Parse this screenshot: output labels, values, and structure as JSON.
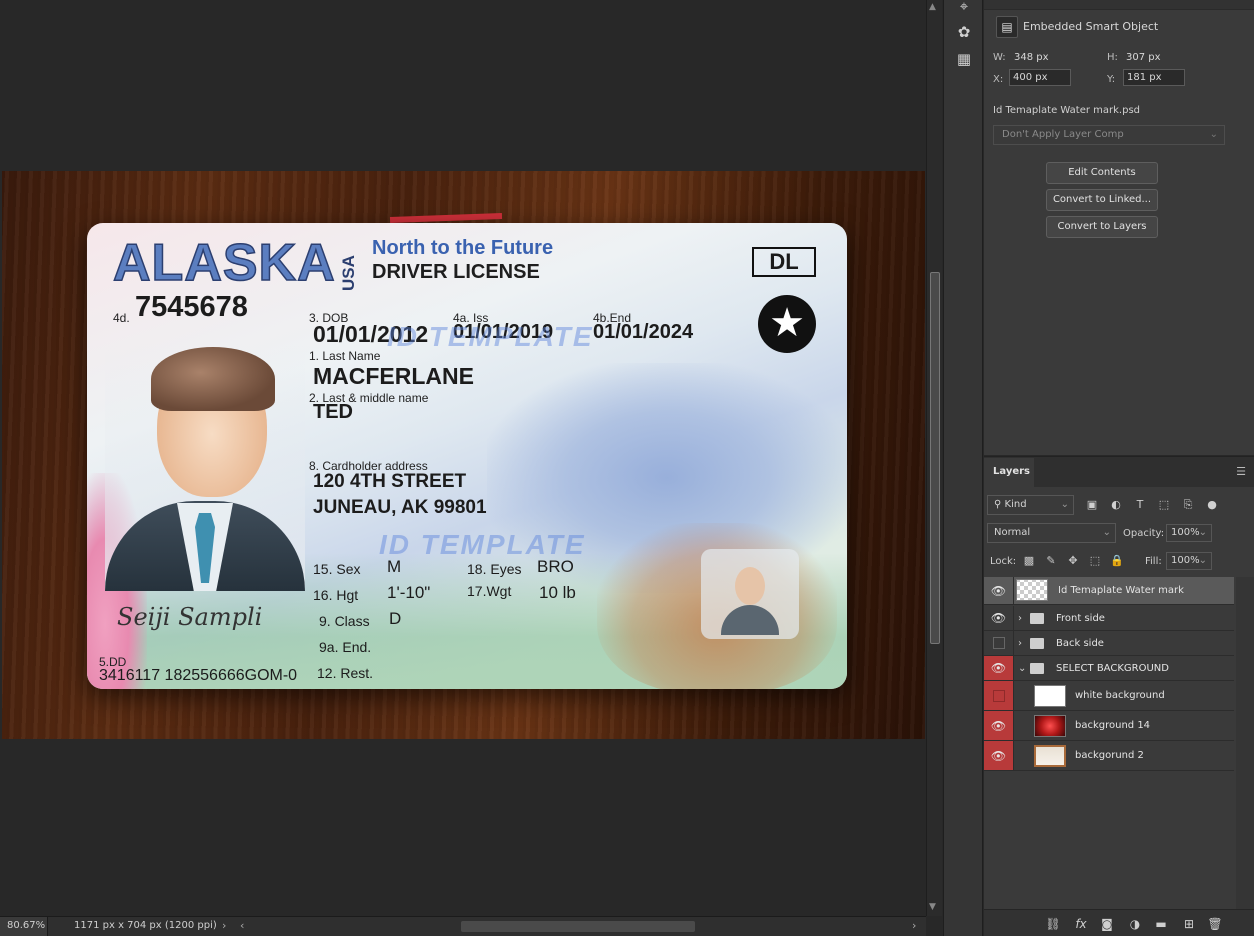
{
  "card": {
    "state": "ALASKA",
    "country": "USA",
    "motto": "North to the Future",
    "doc_type": "DRIVER LICENSE",
    "class_box": "DL",
    "id_label": "4d.",
    "id_number": "7545678",
    "dob_label": "3. DOB",
    "dob": "01/01/2012",
    "iss_label": "4a. Iss",
    "iss": "01/01/2019",
    "end_label": "4b.End",
    "end": "01/01/2024",
    "last_name_label": "1. Last Name",
    "last_name": "MACFERLANE",
    "first_name_label": "2. Last & middle name",
    "first_name": "TED",
    "address_label": "8. Cardholder address",
    "address_line1": "120 4TH STREET",
    "address_line2": "JUNEAU, AK 99801",
    "watermark": "ID TEMPLATE",
    "sex_label": "15. Sex",
    "sex": "M",
    "eyes_label": "18. Eyes",
    "eyes": "BRO",
    "hgt_label": "16. Hgt",
    "hgt": "1'-10\"",
    "wgt_label": "17.Wgt",
    "wgt": "10 lb",
    "class_label": "9.  Class",
    "class": "D",
    "endorse_label": "9a. End.",
    "rest_label": "12. Rest.",
    "signature": "Seiji Sampli",
    "dd_label": "5.DD",
    "dd": "3416117 182556666GOM-0"
  },
  "status_bar": {
    "zoom": "80.67%",
    "doc_info": "1171 px x 704 px (1200 ppi)"
  },
  "properties": {
    "title": "Embedded Smart Object",
    "w_label": "W:",
    "w_value": "348 px",
    "h_label": "H:",
    "h_value": "307 px",
    "x_label": "X:",
    "x_value": "400 px",
    "y_label": "Y:",
    "y_value": "181 px",
    "file_name": "Id Temaplate Water mark.psd",
    "layer_comp": "Don't Apply Layer Comp",
    "buttons": [
      "Edit Contents",
      "Convert to Linked...",
      "Convert to Layers"
    ]
  },
  "layers_panel": {
    "tab": "Layers",
    "kind": "Kind",
    "blend_mode": "Normal",
    "opacity_label": "Opacity:",
    "opacity": "100%",
    "lock_label": "Lock:",
    "fill_label": "Fill:",
    "fill": "100%",
    "layers": [
      {
        "name": "Id Temaplate Water mark",
        "visible": true,
        "selected": true,
        "type": "smart"
      },
      {
        "name": "Front side",
        "visible": true,
        "type": "group"
      },
      {
        "name": "Back side",
        "visible": false,
        "type": "group"
      },
      {
        "name": "SELECT BACKGROUND",
        "visible": true,
        "type": "group-open",
        "highlight": true
      },
      {
        "name": "white background",
        "visible": false,
        "type": "fill-white",
        "highlight": true
      },
      {
        "name": "background 14",
        "visible": true,
        "type": "fill-red",
        "highlight": true
      },
      {
        "name": "backgorund 2",
        "visible": true,
        "type": "fill-frame",
        "highlight": true
      }
    ]
  },
  "icons": {
    "eye": "eye-icon",
    "folder": "folder-icon",
    "link": "link-layers-icon",
    "fx": "fx-icon",
    "mask": "add-mask-icon",
    "adjustment": "adjustment-layer-icon",
    "new_group": "new-group-icon",
    "new_layer": "new-layer-icon",
    "trash": "delete-layer-icon"
  },
  "colors": {
    "highlight_red": "#b83a3a",
    "panel": "#3a3a3a",
    "canvas_bg": "#282828"
  }
}
